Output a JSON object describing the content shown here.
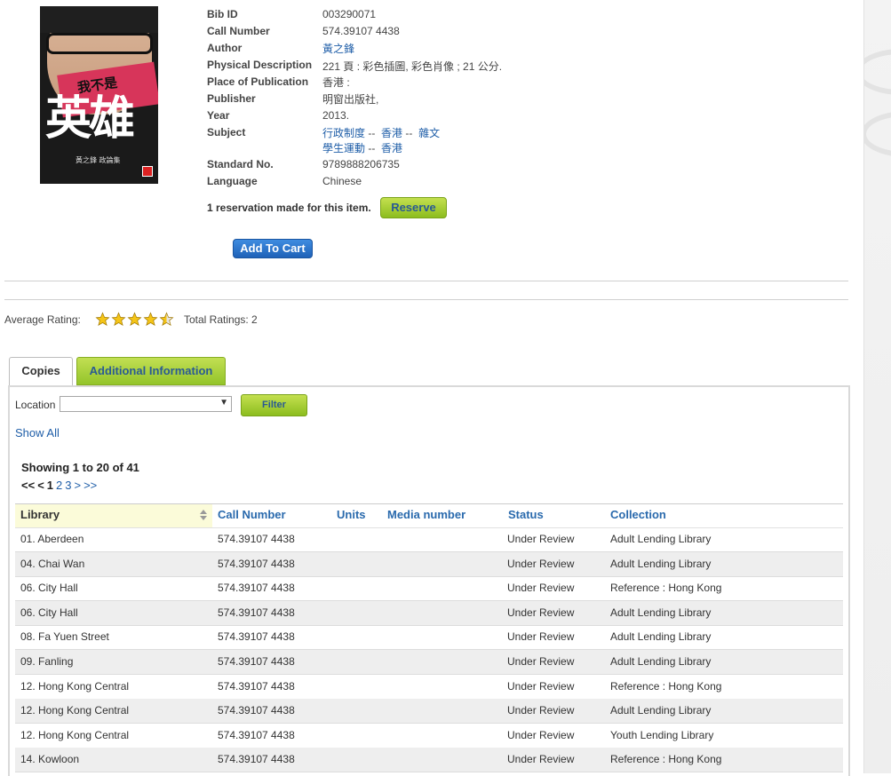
{
  "bib": {
    "fields": [
      {
        "label": "Bib ID",
        "value": "003290071"
      },
      {
        "label": "Call Number",
        "value": "574.39107 4438"
      },
      {
        "label": "Author",
        "value": "黃之鋒",
        "link": true
      },
      {
        "label": "Physical Description",
        "value": "221 頁 : 彩色插圖, 彩色肖像 ; 21 公分."
      },
      {
        "label": "Place of Publication",
        "value": "香港 :"
      },
      {
        "label": "Publisher",
        "value": "明窗出版社,"
      },
      {
        "label": "Year",
        "value": "2013."
      },
      {
        "label": "Subject",
        "value": ""
      },
      {
        "label": "Standard No.",
        "value": "9789888206735"
      },
      {
        "label": "Language",
        "value": "Chinese"
      }
    ],
    "subject_line1": [
      "行政制度",
      "香港",
      "雜文"
    ],
    "subject_line2": [
      "學生運動",
      "香港"
    ],
    "subject_separator": "--"
  },
  "cover": {
    "line1": "我不是",
    "line2": "英雄",
    "line3": "黃之鋒 政論集"
  },
  "reservation": {
    "text": "1 reservation made for this item.",
    "button": "Reserve"
  },
  "cart": {
    "button": "Add To Cart"
  },
  "rating": {
    "label": "Average Rating:",
    "value": 4.5,
    "max": 5,
    "total": "Total Ratings: 2"
  },
  "tabs": [
    {
      "label": "Copies",
      "active": true
    },
    {
      "label": "Additional Information",
      "active": false
    }
  ],
  "filter": {
    "location_label": "Location",
    "selected": "",
    "button": "Filter",
    "show_all": "Show All"
  },
  "results": {
    "showing": "Showing 1 to 20 of 41",
    "pager": {
      "first": "<<",
      "prev": "<",
      "current": "1",
      "pages": [
        "2",
        "3"
      ],
      "next": ">",
      "last": ">>"
    }
  },
  "table": {
    "headers": [
      "Library",
      "Call Number",
      "Units",
      "Media number",
      "Status",
      "Collection"
    ],
    "rows": [
      {
        "library": "01. Aberdeen",
        "call": "574.39107 4438",
        "units": "",
        "media": "",
        "status": "Under Review",
        "collection": "Adult Lending Library"
      },
      {
        "library": "04. Chai Wan",
        "call": "574.39107 4438",
        "units": "",
        "media": "",
        "status": "Under Review",
        "collection": "Adult Lending Library"
      },
      {
        "library": "06. City Hall",
        "call": "574.39107 4438",
        "units": "",
        "media": "",
        "status": "Under Review",
        "collection": "Reference : Hong Kong"
      },
      {
        "library": "06. City Hall",
        "call": "574.39107 4438",
        "units": "",
        "media": "",
        "status": "Under Review",
        "collection": "Adult Lending Library"
      },
      {
        "library": "08. Fa Yuen Street",
        "call": "574.39107 4438",
        "units": "",
        "media": "",
        "status": "Under Review",
        "collection": "Adult Lending Library"
      },
      {
        "library": "09. Fanling",
        "call": "574.39107 4438",
        "units": "",
        "media": "",
        "status": "Under Review",
        "collection": "Adult Lending Library"
      },
      {
        "library": "12. Hong Kong Central",
        "call": "574.39107 4438",
        "units": "",
        "media": "",
        "status": "Under Review",
        "collection": "Reference : Hong Kong"
      },
      {
        "library": "12. Hong Kong Central",
        "call": "574.39107 4438",
        "units": "",
        "media": "",
        "status": "Under Review",
        "collection": "Adult Lending Library"
      },
      {
        "library": "12. Hong Kong Central",
        "call": "574.39107 4438",
        "units": "",
        "media": "",
        "status": "Under Review",
        "collection": "Youth Lending Library"
      },
      {
        "library": "14. Kowloon",
        "call": "574.39107 4438",
        "units": "",
        "media": "",
        "status": "Under Review",
        "collection": "Reference : Hong Kong"
      }
    ]
  },
  "colors": {
    "link": "#1f5ea8",
    "button_green": "#8cbd1f",
    "button_blue": "#1f62b8",
    "alt_row": "#eeeeee",
    "sorted_header": "#fbfbd9"
  },
  "icons": {
    "star": "star-icon",
    "half_star": "half-star-icon",
    "sort": "sort-icon",
    "dropdown": "chevron-down-icon"
  }
}
